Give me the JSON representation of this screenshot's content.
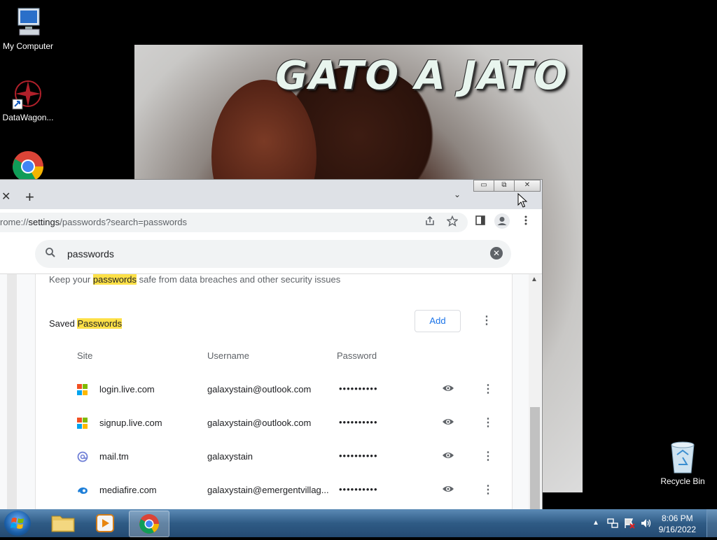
{
  "desktop": {
    "icons": [
      {
        "label": "My Computer",
        "icon": "computer-icon"
      },
      {
        "label": "DataWagon...",
        "icon": "datawagon-icon"
      },
      {
        "label": "",
        "icon": "chrome-icon"
      },
      {
        "label": "Recycle Bin",
        "icon": "recycle-bin-icon"
      }
    ],
    "wallpaper_title": "GATO A JATO"
  },
  "browser": {
    "tab_close": "✕",
    "new_tab": "+",
    "tab_search": "⌄",
    "window_controls": {
      "minimize": "▭",
      "restore": "⧉",
      "close": "✕"
    },
    "url_prefix": "rome://",
    "url_path": "settings",
    "url_rest": "/passwords?search=passwords",
    "settings_search": {
      "value": "passwords",
      "clear": "✕"
    },
    "description_before": "Keep your ",
    "description_highlight": "passwords",
    "description_after": " safe from data breaches and other security issues",
    "saved_prefix": "Saved ",
    "saved_highlight": "Passwords",
    "add_label": "Add",
    "columns": [
      "Site",
      "Username",
      "Password"
    ],
    "rows": [
      {
        "site": "login.live.com",
        "username": "galaxystain@outlook.com",
        "password": "••••••••••",
        "icon": "microsoft-icon"
      },
      {
        "site": "signup.live.com",
        "username": "galaxystain@outlook.com",
        "password": "••••••••••",
        "icon": "microsoft-icon"
      },
      {
        "site": "mail.tm",
        "username": "galaxystain",
        "password": "••••••••••",
        "icon": "mailtm-icon"
      },
      {
        "site": "mediafire.com",
        "username": "galaxystain@emergentvillag...",
        "password": "••••••••••",
        "icon": "mediafire-icon"
      }
    ]
  },
  "taskbar": {
    "clock_time": "8:06 PM",
    "clock_date": "9/16/2022"
  },
  "colors": {
    "highlight": "#fde047",
    "accent": "#1a73e8"
  }
}
